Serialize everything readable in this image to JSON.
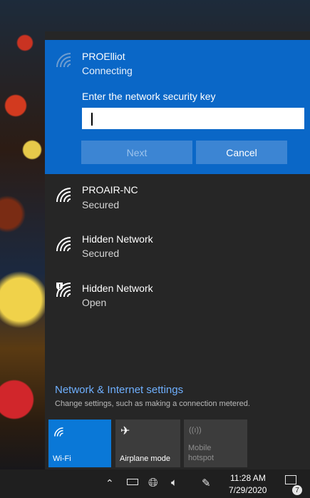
{
  "networks": {
    "active": {
      "name": "PROElliot",
      "status": "Connecting"
    },
    "security_prompt": "Enter the network security key",
    "key_value": "",
    "next_label": "Next",
    "cancel_label": "Cancel",
    "list": [
      {
        "name": "PROAIR-NC",
        "status": "Secured"
      },
      {
        "name": "Hidden Network",
        "status": "Secured"
      },
      {
        "name": "Hidden Network",
        "status": "Open"
      }
    ]
  },
  "settings": {
    "link": "Network & Internet settings",
    "description": "Change settings, such as making a connection metered."
  },
  "quick_actions": [
    {
      "label": "Wi-Fi",
      "state": "on",
      "icon": "wifi-icon"
    },
    {
      "label": "Airplane mode",
      "state": "off",
      "icon": "airplane-icon"
    },
    {
      "label": "Mobile hotspot",
      "state": "disabled",
      "icon": "hotspot-icon"
    }
  ],
  "taskbar": {
    "time": "11:28 AM",
    "date": "7/29/2020",
    "notification_count": "7"
  },
  "colors": {
    "accent": "#0a67c7",
    "panel": "#262626",
    "link": "#6fb0ff"
  }
}
